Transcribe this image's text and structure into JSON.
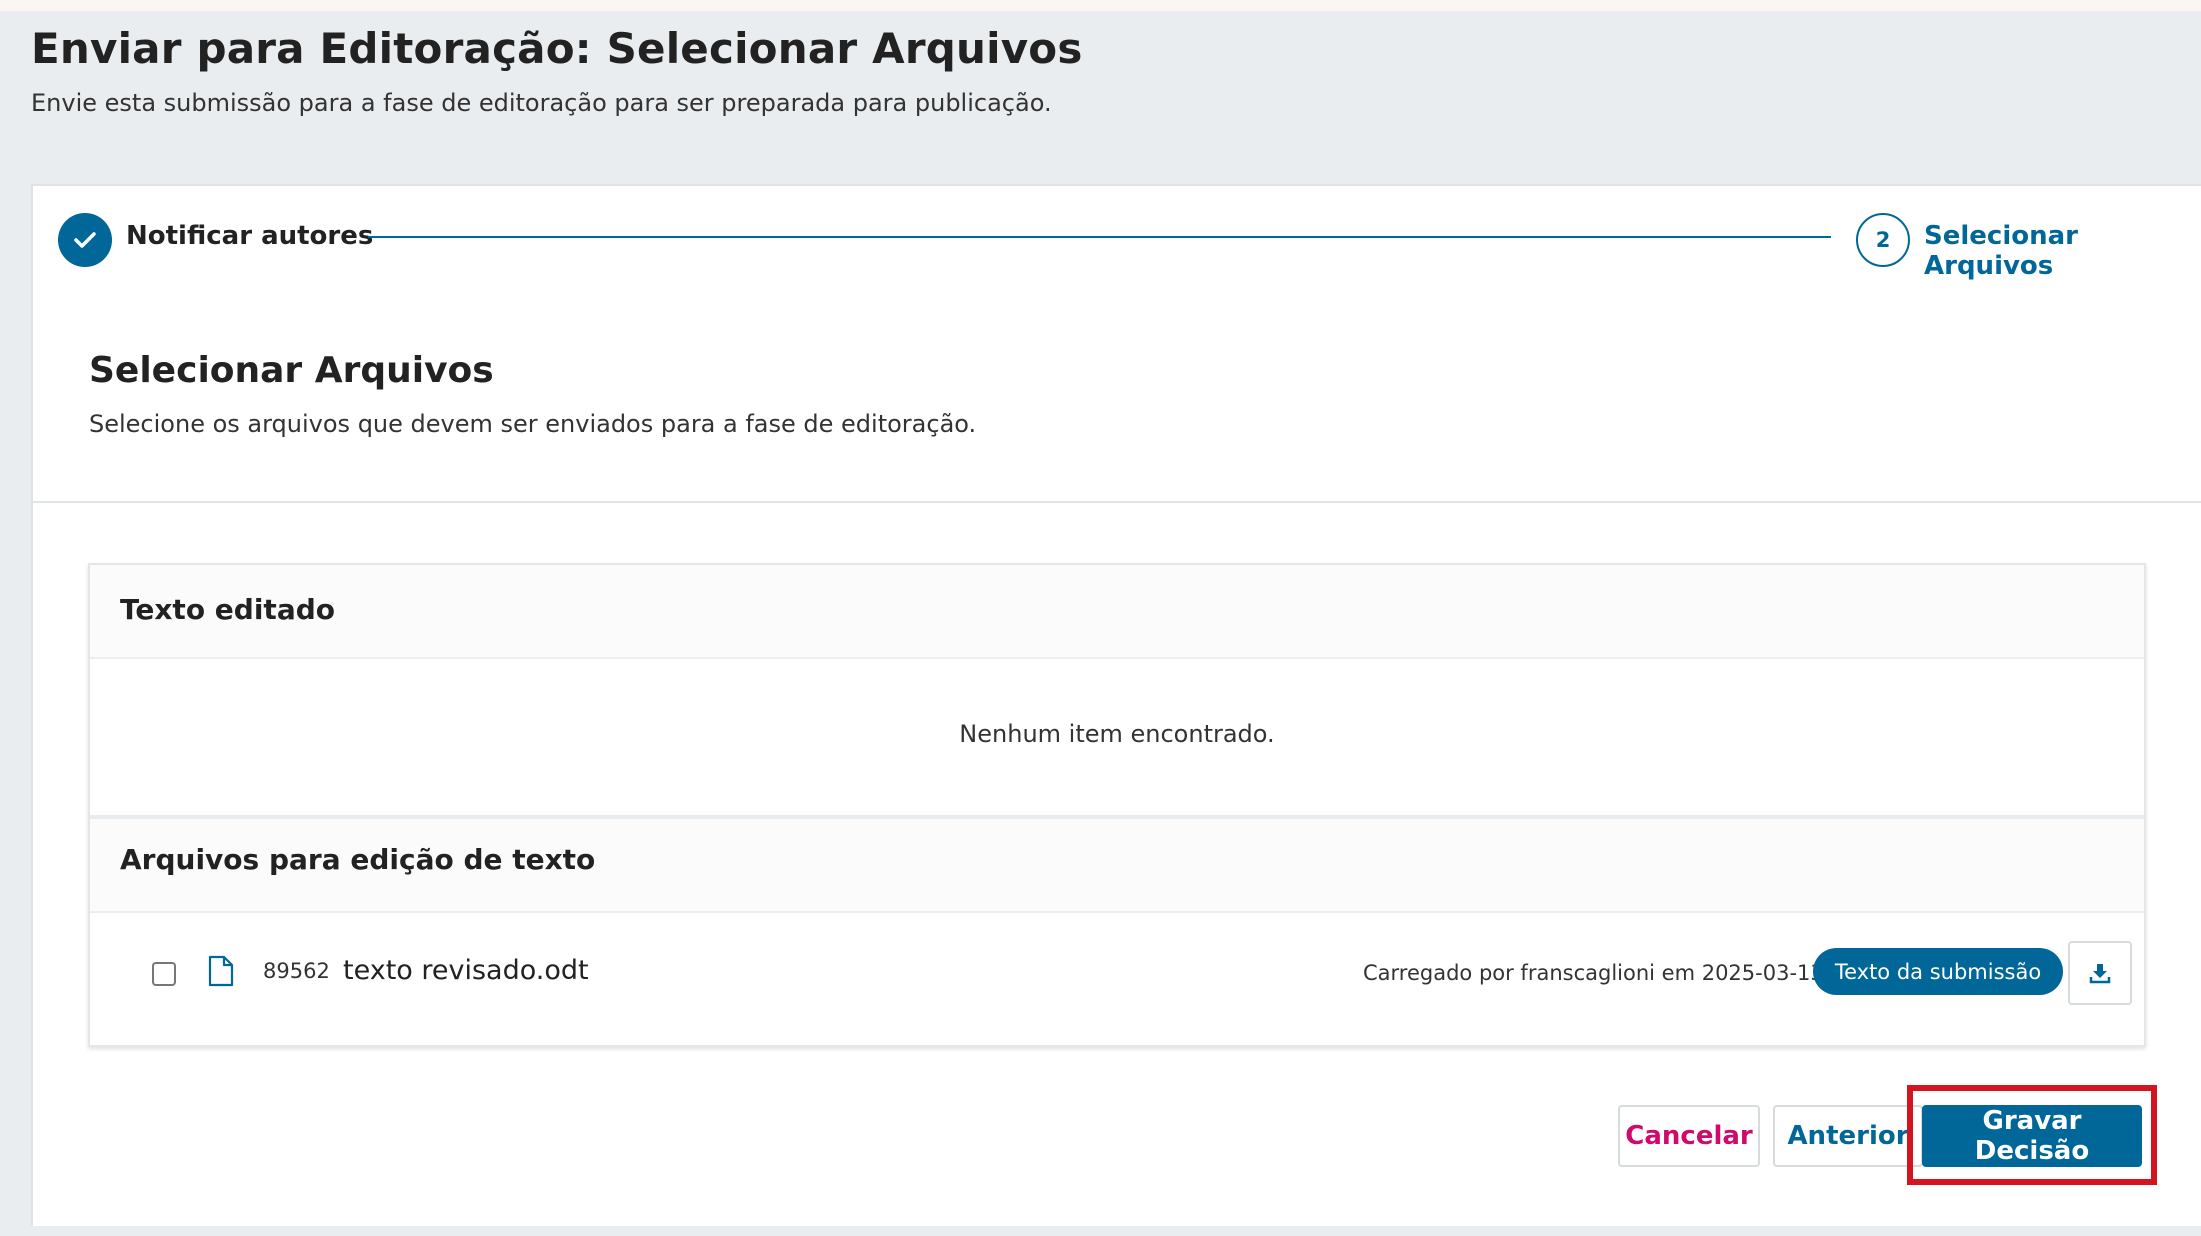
{
  "header": {
    "title": "Enviar para Editoração: Selecionar Arquivos",
    "subtitle": "Envie esta submissão para a fase de editoração para ser preparada para publicação."
  },
  "steps": [
    {
      "label": "Notificar autores",
      "status": "complete"
    },
    {
      "number": "2",
      "label": "Selecionar Arquivos",
      "status": "current"
    }
  ],
  "section": {
    "title": "Selecionar Arquivos",
    "description": "Selecione os arquivos que devem ser enviados para a fase de editoração."
  },
  "lists": [
    {
      "title": "Texto editado",
      "empty_message": "Nenhum item encontrado."
    },
    {
      "title": "Arquivos para edição de texto",
      "files": [
        {
          "id": "89562",
          "name": "texto revisado.odt",
          "uploaded": "Carregado por franscaglioni em 2025-03-13",
          "badge": "Texto da submissão",
          "checked": false
        }
      ]
    }
  ],
  "actions": {
    "cancel": "Cancelar",
    "previous": "Anterior",
    "save": "Gravar Decisão"
  },
  "colors": {
    "primary": "#006798",
    "cancel": "#d00a6c",
    "highlight": "#d4141e"
  },
  "icons": {
    "step_complete": "check-icon",
    "file": "file-icon",
    "download": "download-icon"
  }
}
